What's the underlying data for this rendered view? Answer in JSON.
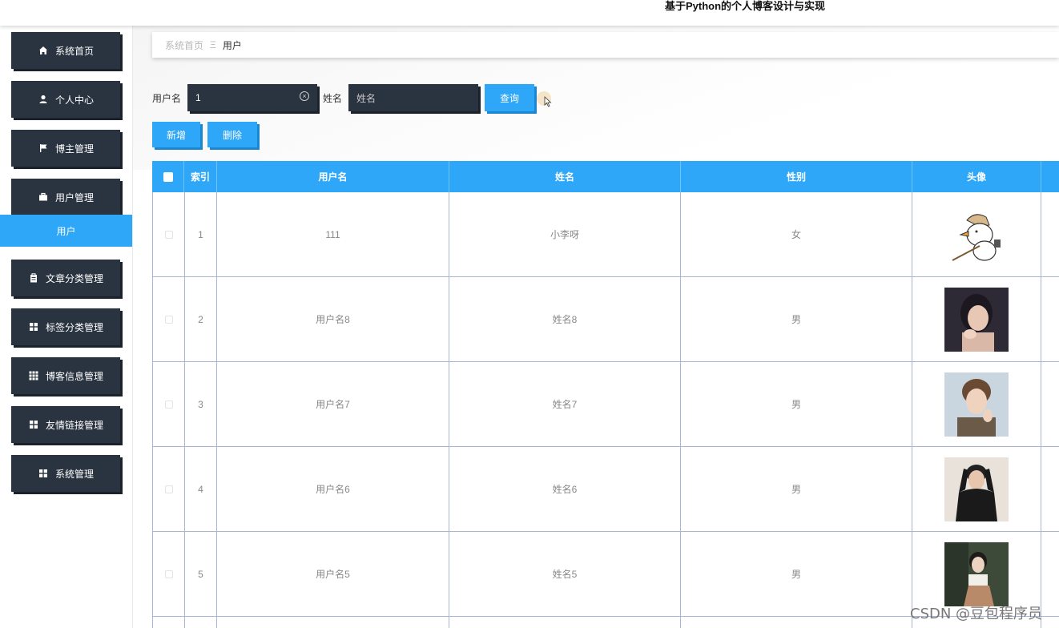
{
  "app": {
    "title": "基于Python的个人博客设计与实现"
  },
  "sidebar": {
    "items": [
      {
        "label": "系统首页",
        "icon": "home-icon"
      },
      {
        "label": "个人中心",
        "icon": "user-icon"
      },
      {
        "label": "博主管理",
        "icon": "flag-icon"
      },
      {
        "label": "用户管理",
        "icon": "briefcase-icon"
      },
      {
        "label": "文章分类管理",
        "icon": "clipboard-icon"
      },
      {
        "label": "标签分类管理",
        "icon": "grid-icon"
      },
      {
        "label": "博客信息管理",
        "icon": "grid-nine-icon"
      },
      {
        "label": "友情链接管理",
        "icon": "grid-icon"
      },
      {
        "label": "系统管理",
        "icon": "grid-icon"
      }
    ],
    "active_submenu": "用户"
  },
  "breadcrumb": {
    "home": "系统首页",
    "separator": "Ξ",
    "current": "用户"
  },
  "search": {
    "username_label": "用户名",
    "username_value": "1",
    "name_label": "姓名",
    "name_placeholder": "姓名",
    "query_button": "查询"
  },
  "actions": {
    "add": "新增",
    "delete": "删除"
  },
  "table": {
    "columns": [
      "索引",
      "用户名",
      "姓名",
      "性别",
      "头像"
    ],
    "rows": [
      {
        "index": "1",
        "username": "111",
        "name": "小李呀",
        "gender": "女",
        "avatar": "cartoon-duck"
      },
      {
        "index": "2",
        "username": "用户名8",
        "name": "姓名8",
        "gender": "男",
        "avatar": "photo-woman"
      },
      {
        "index": "3",
        "username": "用户名7",
        "name": "姓名7",
        "gender": "男",
        "avatar": "photo-man"
      },
      {
        "index": "4",
        "username": "用户名6",
        "name": "姓名6",
        "gender": "男",
        "avatar": "photo-man-dark"
      },
      {
        "index": "5",
        "username": "用户名5",
        "name": "姓名5",
        "gender": "男",
        "avatar": "photo-woman-outdoor"
      }
    ]
  },
  "watermark": "CSDN @豆包程序员",
  "colors": {
    "accent": "#2ea7f8",
    "dark": "#2a3340"
  }
}
